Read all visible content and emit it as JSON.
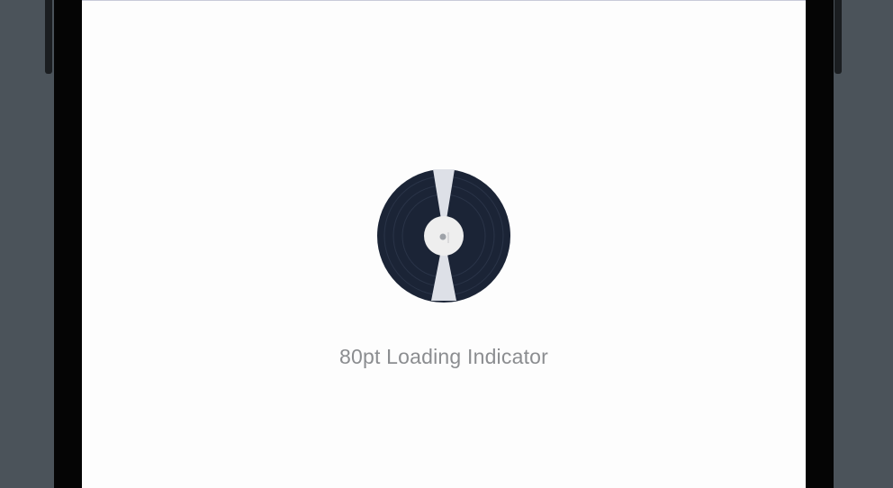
{
  "loader": {
    "size_label": "80pt Loading Indicator",
    "icon": "vinyl-record-icon",
    "colors": {
      "disc": "#1b2436",
      "groove": "#2a3448",
      "wedge": "#dde0e7",
      "label": "#eeeeee",
      "spindle": "#9ea2a8",
      "caption": "#8b8d90",
      "screen": "#fdfdfd",
      "bezel": "#050505",
      "desk": "#4b535a"
    }
  }
}
